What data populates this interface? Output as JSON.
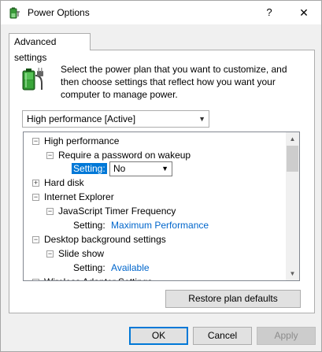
{
  "window": {
    "title": "Power Options",
    "help_label": "?",
    "close_label": "✕"
  },
  "tab": {
    "label": "Advanced settings"
  },
  "description": "Select the power plan that you want to customize, and then choose settings that reflect how you want your computer to manage power.",
  "plan_combo": {
    "value": "High performance [Active]"
  },
  "tree": {
    "items": [
      {
        "label": "High performance",
        "expander": "−"
      },
      {
        "label": "Require a password on wakeup",
        "expander": "−"
      },
      {
        "setting_label": "Setting:",
        "value": "No"
      },
      {
        "label": "Hard disk",
        "expander": "+"
      },
      {
        "label": "Internet Explorer",
        "expander": "−"
      },
      {
        "label": "JavaScript Timer Frequency",
        "expander": "−"
      },
      {
        "setting_label": "Setting:",
        "value": "Maximum Performance"
      },
      {
        "label": "Desktop background settings",
        "expander": "−"
      },
      {
        "label": "Slide show",
        "expander": "−"
      },
      {
        "setting_label": "Setting:",
        "value": "Available"
      },
      {
        "label": "Wireless Adapter Settings",
        "expander": "−"
      }
    ]
  },
  "buttons": {
    "restore": "Restore plan defaults",
    "ok": "OK",
    "cancel": "Cancel",
    "apply": "Apply"
  },
  "icons": {
    "title": "power-options-icon",
    "battery": "battery-power-plug-icon",
    "expand": "expand-icon",
    "collapse": "collapse-icon",
    "scroll_up": "scroll-up-arrow-icon",
    "scroll_down": "scroll-down-arrow-icon"
  },
  "colors": {
    "accent": "#0078d7",
    "link": "#0066cc"
  }
}
